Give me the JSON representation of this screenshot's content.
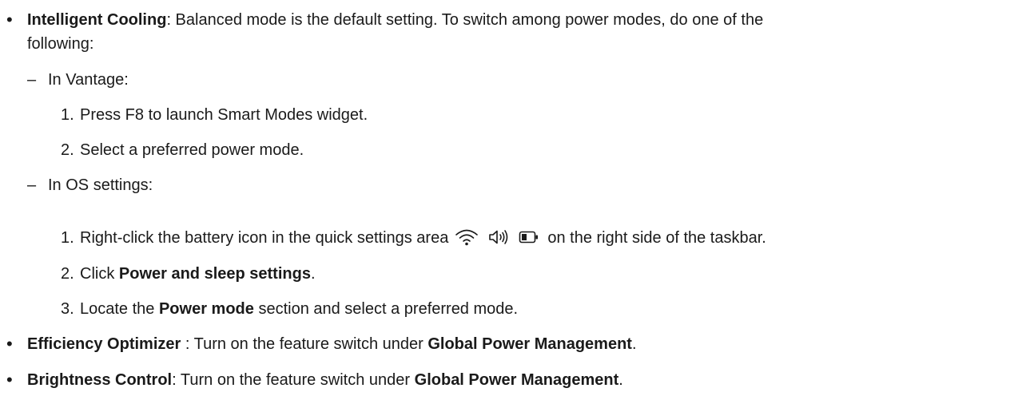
{
  "items": [
    {
      "title": "Intelligent Cooling",
      "text_line1": ": Balanced mode is the default setting. To switch among power modes, do one of the",
      "text_line2": "following:",
      "subitems": [
        {
          "label": "In Vantage:",
          "steps": [
            {
              "num": "1.",
              "text": "Press F8 to launch Smart Modes widget."
            },
            {
              "num": "2.",
              "text": "Select a preferred power mode."
            }
          ]
        },
        {
          "label": "In OS settings:",
          "steps": [
            {
              "num": "1.",
              "before": "Right-click the battery icon in the quick settings area",
              "after": "on the right side of the taskbar."
            },
            {
              "num": "2.",
              "before": "Click ",
              "bold": "Power and sleep settings",
              "after": "."
            },
            {
              "num": "3.",
              "before": "Locate the ",
              "bold": "Power mode",
              "after": " section and select a preferred mode."
            }
          ]
        }
      ]
    },
    {
      "title": "Efficiency Optimizer",
      "text": " : Turn on the feature switch under ",
      "bold2": "Global Power Management",
      "end": "."
    },
    {
      "title": "Brightness Control",
      "text": ": Turn on the feature switch under ",
      "bold2": "Global Power Management",
      "end": "."
    }
  ],
  "icons": [
    "wifi-icon",
    "volume-icon",
    "battery-icon"
  ],
  "bullet": "•",
  "dash": "–"
}
